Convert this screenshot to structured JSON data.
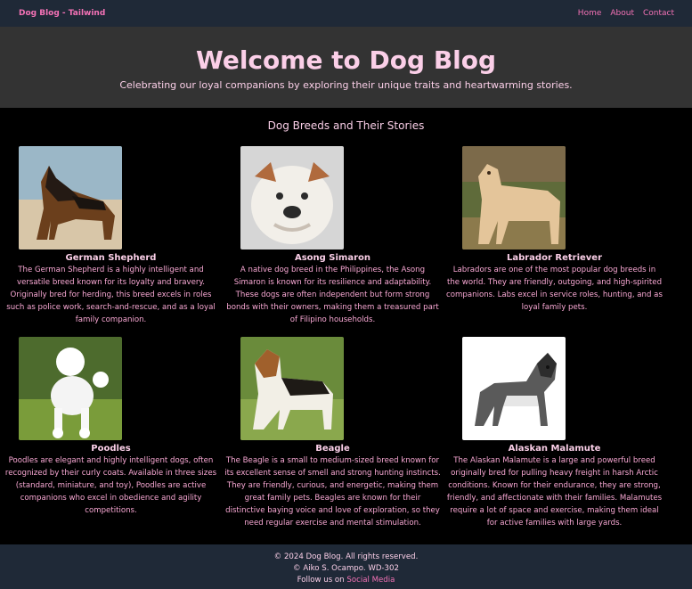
{
  "nav": {
    "brand": "Dog Blog - Tailwind",
    "links": [
      "Home",
      "About",
      "Contact"
    ]
  },
  "hero": {
    "title": "Welcome to Dog Blog",
    "subtitle": "Celebrating our loyal companions by exploring their unique traits and heartwarming stories."
  },
  "section": {
    "title": "Dog Breeds and Their Stories"
  },
  "breeds": [
    {
      "name": "German Shepherd",
      "description": "The German Shepherd is a highly intelligent and versatile breed known for its loyalty and bravery. Originally bred for herding, this breed excels in roles such as police work, search-and-rescue, and as a loyal family companion.",
      "image": "german-shepherd-photo"
    },
    {
      "name": "Asong Simaron",
      "description": "A native dog breed in the Philippines, the Asong Simaron is known for its resilience and adaptability. These dogs are often independent but form strong bonds with their owners, making them a treasured part of Filipino households.",
      "image": "bulldog-photo"
    },
    {
      "name": "Labrador Retriever",
      "description": "Labradors are one of the most popular dog breeds in the world. They are friendly, outgoing, and high-spirited companions. Labs excel in service roles, hunting, and as loyal family pets.",
      "image": "labrador-photo"
    },
    {
      "name": "Poodles",
      "description": "Poodles are elegant and highly intelligent dogs, often recognized by their curly coats. Available in three sizes (standard, miniature, and toy), Poodles are active companions who excel in obedience and agility competitions.",
      "image": "poodle-photo"
    },
    {
      "name": "Beagle",
      "description": "The Beagle is a small to medium-sized breed known for its excellent sense of smell and strong hunting instincts. They are friendly, curious, and energetic, making them great family pets. Beagles are known for their distinctive baying voice and love of exploration, so they need regular exercise and mental stimulation.",
      "image": "beagle-photo"
    },
    {
      "name": "Alaskan Malamute",
      "description": "The Alaskan Malamute is a large and powerful breed originally bred for pulling heavy freight in harsh Arctic conditions. Known for their endurance, they are strong, friendly, and affectionate with their families. Malamutes require a lot of space and exercise, making them ideal for active families with large yards.",
      "image": "malamute-photo"
    }
  ],
  "footer": {
    "copyright": "© 2024 Dog Blog. All rights reserved.",
    "author": "© Aiko S. Ocampo. WD-302",
    "follow_prefix": "Follow us on",
    "follow_link": "Social Media"
  },
  "colors": {
    "nav_bg": "#1f2937",
    "hero_bg": "#333333",
    "page_bg": "#000000",
    "accent_pink": "#f472b6",
    "light_pink": "#fbcfe8"
  }
}
